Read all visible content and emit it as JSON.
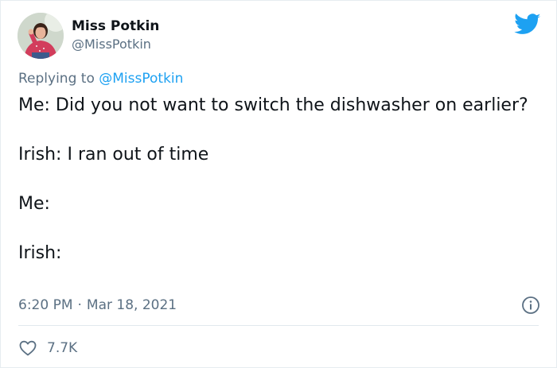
{
  "author": {
    "display_name": "Miss Potkin",
    "handle": "@MissPotkin"
  },
  "reply_context": {
    "prefix": "Replying to ",
    "mention": "@MissPotkin"
  },
  "body": {
    "lines": [
      "Me: Did you not want to switch the dishwasher on earlier?",
      "Irish: I ran out of time",
      "Me:",
      "Irish:"
    ]
  },
  "meta": {
    "time": "6:20 PM",
    "separator": "·",
    "date": "Mar 18, 2021"
  },
  "actions": {
    "like_count": "7.7K"
  },
  "colors": {
    "brand_blue": "#1da1f2",
    "secondary_text": "#5b7083",
    "primary_text": "#0f1419"
  },
  "icons": {
    "brand": "twitter-bird-icon",
    "info": "info-icon",
    "like": "heart-icon"
  }
}
